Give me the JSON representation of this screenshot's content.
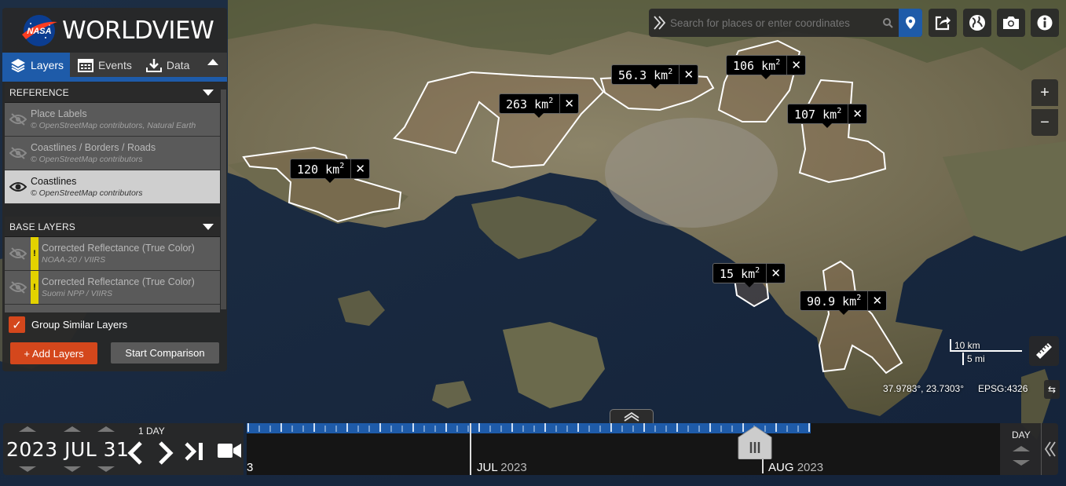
{
  "app": {
    "name": "WORLDVIEW",
    "logo": "NASA"
  },
  "tabs": [
    {
      "label": "Layers",
      "icon": "layers-icon",
      "active": true
    },
    {
      "label": "Events",
      "icon": "calendar-icon",
      "active": false
    },
    {
      "label": "Data",
      "icon": "download-icon",
      "active": false
    }
  ],
  "reference": {
    "header": "REFERENCE",
    "layers": [
      {
        "name": "Place Labels",
        "attribution": "© OpenStreetMap contributors, Natural Earth",
        "visible": false
      },
      {
        "name": "Coastlines / Borders / Roads",
        "attribution": "© OpenStreetMap contributors",
        "visible": false
      },
      {
        "name": "Coastlines",
        "attribution": "© OpenStreetMap contributors",
        "visible": true
      }
    ]
  },
  "base": {
    "header": "BASE LAYERS",
    "layers": [
      {
        "name": "Corrected Reflectance (True Color)",
        "attribution": "NOAA-20 / VIIRS",
        "visible": false,
        "warning": "!"
      },
      {
        "name": "Corrected Reflectance (True Color)",
        "attribution": "Suomi NPP / VIIRS",
        "visible": false,
        "warning": "!"
      }
    ]
  },
  "controls": {
    "group_similar": "Group Similar Layers",
    "add_layers": "+ Add Layers",
    "start_comparison": "Start Comparison"
  },
  "search": {
    "placeholder": "Search for places or enter coordinates"
  },
  "map": {
    "zoom_in": "+",
    "zoom_out": "−",
    "measurements": [
      {
        "value": "263",
        "unit": "km",
        "exp": "2"
      },
      {
        "value": "56.3",
        "unit": "km",
        "exp": "2"
      },
      {
        "value": "106",
        "unit": "km",
        "exp": "2"
      },
      {
        "value": "107",
        "unit": "km",
        "exp": "2"
      },
      {
        "value": "120",
        "unit": "km",
        "exp": "2"
      },
      {
        "value": "15",
        "unit": "km",
        "exp": "2"
      },
      {
        "value": "90.9",
        "unit": "km",
        "exp": "2"
      }
    ],
    "close_symbol": "✕",
    "scale": {
      "km": "10 km",
      "mi": "5 mi"
    },
    "coordinates": "37.9783°, 23.7303°",
    "projection": "EPSG:4326"
  },
  "timeline": {
    "date": "2023 JUL 31",
    "interval": "1  DAY",
    "zoom_level": "DAY",
    "months": [
      {
        "label": "JUL",
        "year": "2023"
      },
      {
        "label": "AUG",
        "year": "2023"
      }
    ],
    "left_stub": "3"
  },
  "colors": {
    "accent_blue": "#1e5ba9",
    "accent_orange": "#d4471c",
    "warning_yellow": "#e3d200",
    "panel": "#282828"
  }
}
